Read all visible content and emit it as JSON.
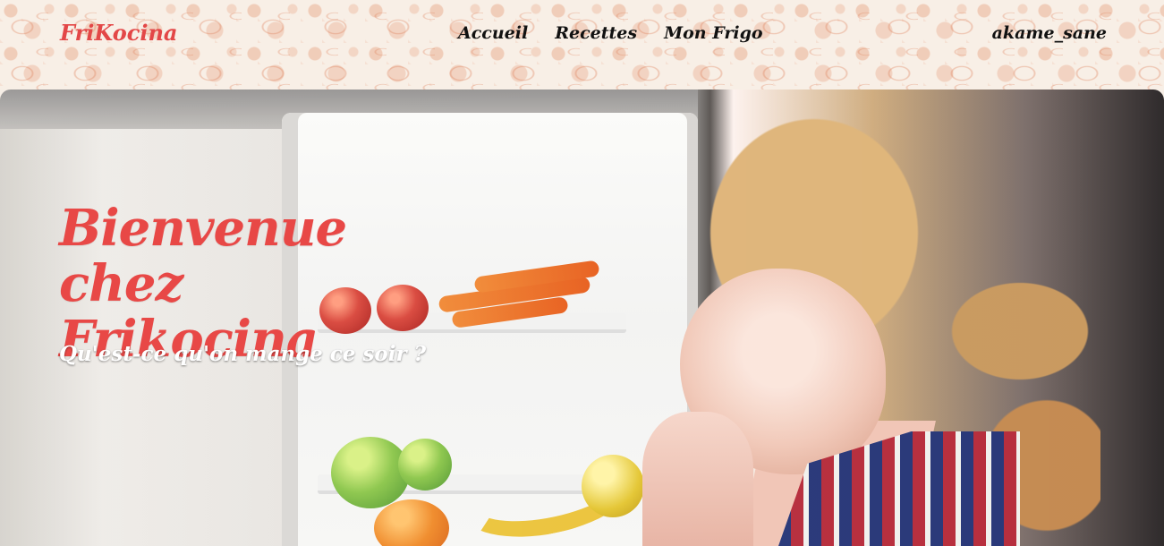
{
  "header": {
    "brand": "FriKocina",
    "nav": [
      {
        "label": "Accueil"
      },
      {
        "label": "Recettes"
      },
      {
        "label": "Mon Frigo"
      }
    ],
    "username": "akame_sane"
  },
  "hero": {
    "title": "Bienvenue chez Frikocina",
    "subtitle": "Qu'est-ce qu'on mange ce soir ?"
  },
  "colors": {
    "accent": "#e84846",
    "header_bg": "#f8efe6",
    "text": "#111111"
  }
}
